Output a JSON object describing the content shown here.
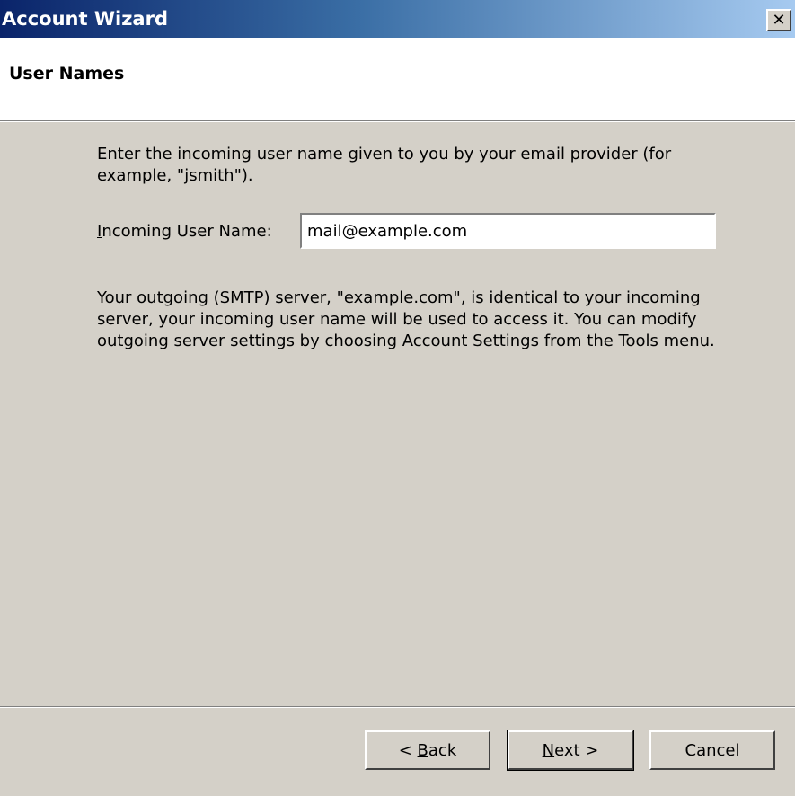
{
  "window": {
    "title": "Account Wizard",
    "close_glyph": "✕"
  },
  "page": {
    "title": "User Names",
    "intro": "Enter the incoming user name given to you by your email provider (for example, \"jsmith\").",
    "smtp_info": "Your outgoing (SMTP) server, \"example.com\", is identical to your incoming server, your incoming user name will be used to access it. You can modify outgoing server settings by choosing Account Settings from the Tools menu."
  },
  "form": {
    "incoming_user_name_label_accel": "I",
    "incoming_user_name_label_rest": "ncoming User Name:",
    "incoming_user_name_value": "mail@example.com"
  },
  "buttons": {
    "back_prefix": "< ",
    "back_accel": "B",
    "back_rest": "ack",
    "next_accel": "N",
    "next_rest": "ext >",
    "cancel": "Cancel"
  },
  "colors": {
    "title_gradient_start": "#0a246a",
    "title_gradient_end": "#a6caf0",
    "dialog_face": "#d4d0c8",
    "header_bg": "#ffffff"
  },
  "icons": {
    "close": "close-icon"
  }
}
